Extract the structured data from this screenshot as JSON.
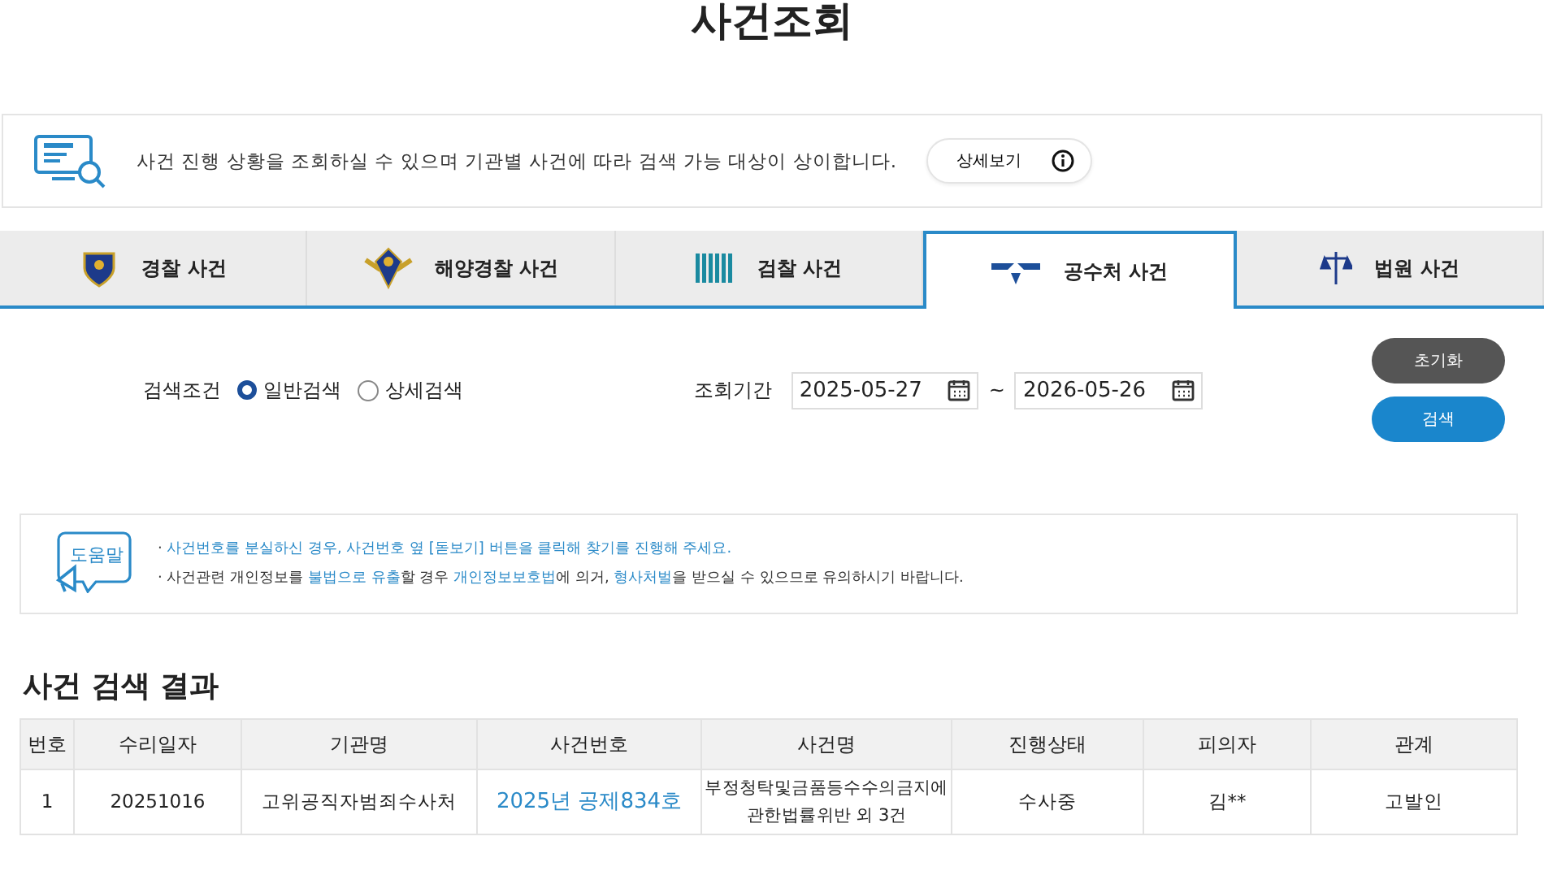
{
  "page_title": "사건조회",
  "info": {
    "text": "사건 진행 상황을 조회하실 수 있으며 기관별 사건에 따라 검색 가능 대상이 상이합니다.",
    "button": "상세보기"
  },
  "tabs": [
    {
      "label": "경찰 사건",
      "selected": false,
      "kind": "police"
    },
    {
      "label": "해양경찰 사건",
      "selected": false,
      "kind": "coast"
    },
    {
      "label": "검찰 사건",
      "selected": false,
      "kind": "prosecution"
    },
    {
      "label": "공수처 사건",
      "selected": true,
      "kind": "cio"
    },
    {
      "label": "법원 사건",
      "selected": false,
      "kind": "court"
    }
  ],
  "search": {
    "condition_label": "검색조건",
    "options": [
      {
        "label": "일반검색",
        "selected": true
      },
      {
        "label": "상세검색",
        "selected": false
      }
    ],
    "period_label": "조회기간",
    "date_from": "2025-05-27",
    "separator": "~",
    "date_to": "2026-05-26",
    "reset_button": "초기화",
    "search_button": "검색"
  },
  "help": {
    "icon_label": "도움말",
    "lines": [
      [
        {
          "text": "· ",
          "kind": "plain"
        },
        {
          "text": "사건번호를 분실하신 경우, 사건번호 옆 [돋보기] 버튼을 클릭해 찾기를 진행해 주세요.",
          "kind": "highlight"
        }
      ],
      [
        {
          "text": "· ",
          "kind": "plain"
        },
        {
          "text": "사건관련 개인정보를 ",
          "kind": "plain"
        },
        {
          "text": "불법으로 유출",
          "kind": "highlight"
        },
        {
          "text": "할 경우 ",
          "kind": "plain"
        },
        {
          "text": "개인정보보호법",
          "kind": "highlight"
        },
        {
          "text": "에 의거, ",
          "kind": "plain"
        },
        {
          "text": "형사처벌",
          "kind": "highlight"
        },
        {
          "text": "을 받으실 수 있으므로 유의하시기 바랍니다.",
          "kind": "plain"
        }
      ]
    ]
  },
  "results": {
    "title": "사건 검색 결과",
    "columns": [
      "번호",
      "수리일자",
      "기관명",
      "사건번호",
      "사건명",
      "진행상태",
      "피의자",
      "관계"
    ],
    "rows": [
      [
        "1",
        "20251016",
        "고위공직자범죄수사처",
        "2025년 공제834호",
        "부정청탁및금품등수수의금지에관한법률위반 외 3건",
        "수사중",
        "김**",
        "고발인"
      ]
    ]
  }
}
